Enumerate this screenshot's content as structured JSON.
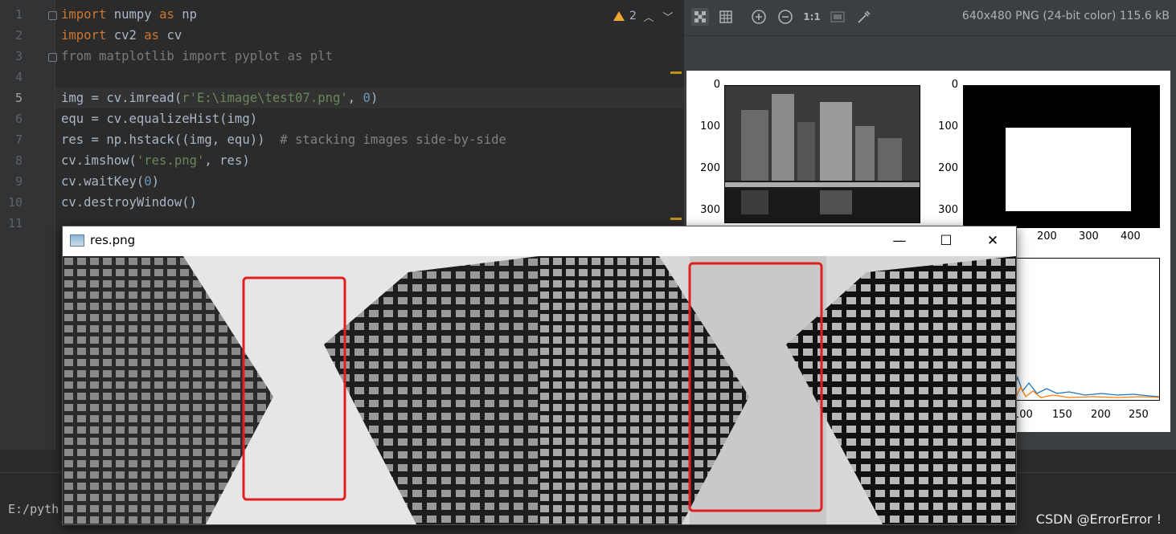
{
  "editor": {
    "lines": [
      {
        "n": "1",
        "cls": "",
        "html": "<span class=\"kw\">import</span> numpy <span class=\"kw\">as</span> np"
      },
      {
        "n": "2",
        "cls": "",
        "html": "<span class=\"kw\">import</span> cv2 <span class=\"kw\">as</span> cv"
      },
      {
        "n": "3",
        "cls": "",
        "html": "<span class=\"dim\">from matplotlib import pyplot as plt</span>"
      },
      {
        "n": "4",
        "cls": "",
        "html": ""
      },
      {
        "n": "5",
        "cls": "cur",
        "html": "img = cv.imread(<span class=\"str\">r'E:\\image\\test07.png'</span>, <span class=\"num\">0</span>)"
      },
      {
        "n": "6",
        "cls": "",
        "html": "equ = cv.equalizeHist(img)"
      },
      {
        "n": "7",
        "cls": "",
        "html": "res = np.hstack((img, equ))  <span class=\"cm\"># stacking images side-by-side</span>"
      },
      {
        "n": "8",
        "cls": "",
        "html": "cv.imshow(<span class=\"str\">'res.png'</span>, res)"
      },
      {
        "n": "9",
        "cls": "",
        "html": "cv.waitKey(<span class=\"num\">0</span>)"
      },
      {
        "n": "10",
        "cls": "",
        "html": "cv.destroyWindow()"
      },
      {
        "n": "11",
        "cls": "",
        "html": ""
      }
    ],
    "warning_count": "2",
    "warning_icon": "warning-triangle-icon",
    "colors": {
      "background": "#2b2b2b",
      "keyword": "#cc7832",
      "string": "#6a8759",
      "number": "#6897bb",
      "comment": "#808080"
    }
  },
  "viewer": {
    "info": "640x480 PNG (24-bit color) 115.6 kB",
    "zoom_label": "1:1",
    "tools": [
      "chessboard-icon",
      "grid-icon",
      "zoom-in-icon",
      "zoom-out-icon",
      "actual-size-icon",
      "fit-icon",
      "color-picker-icon"
    ]
  },
  "plot": {
    "top_left": {
      "yticks": [
        "0",
        "100",
        "200",
        "300"
      ]
    },
    "top_right": {
      "yticks": [
        "0",
        "100",
        "200",
        "300"
      ],
      "xticks": [
        "200",
        "300",
        "400"
      ]
    },
    "histogram": {
      "xticks": [
        "100",
        "150",
        "200",
        "250"
      ],
      "series_colors": [
        "#1f77b4",
        "#ff7f0e"
      ]
    }
  },
  "cvwindow": {
    "title": "res.png",
    "minimize": "—",
    "maximize": "☐",
    "close": "✕"
  },
  "terminal": {
    "text": "E:/pyth"
  },
  "watermark": "CSDN @ErrorError !"
}
